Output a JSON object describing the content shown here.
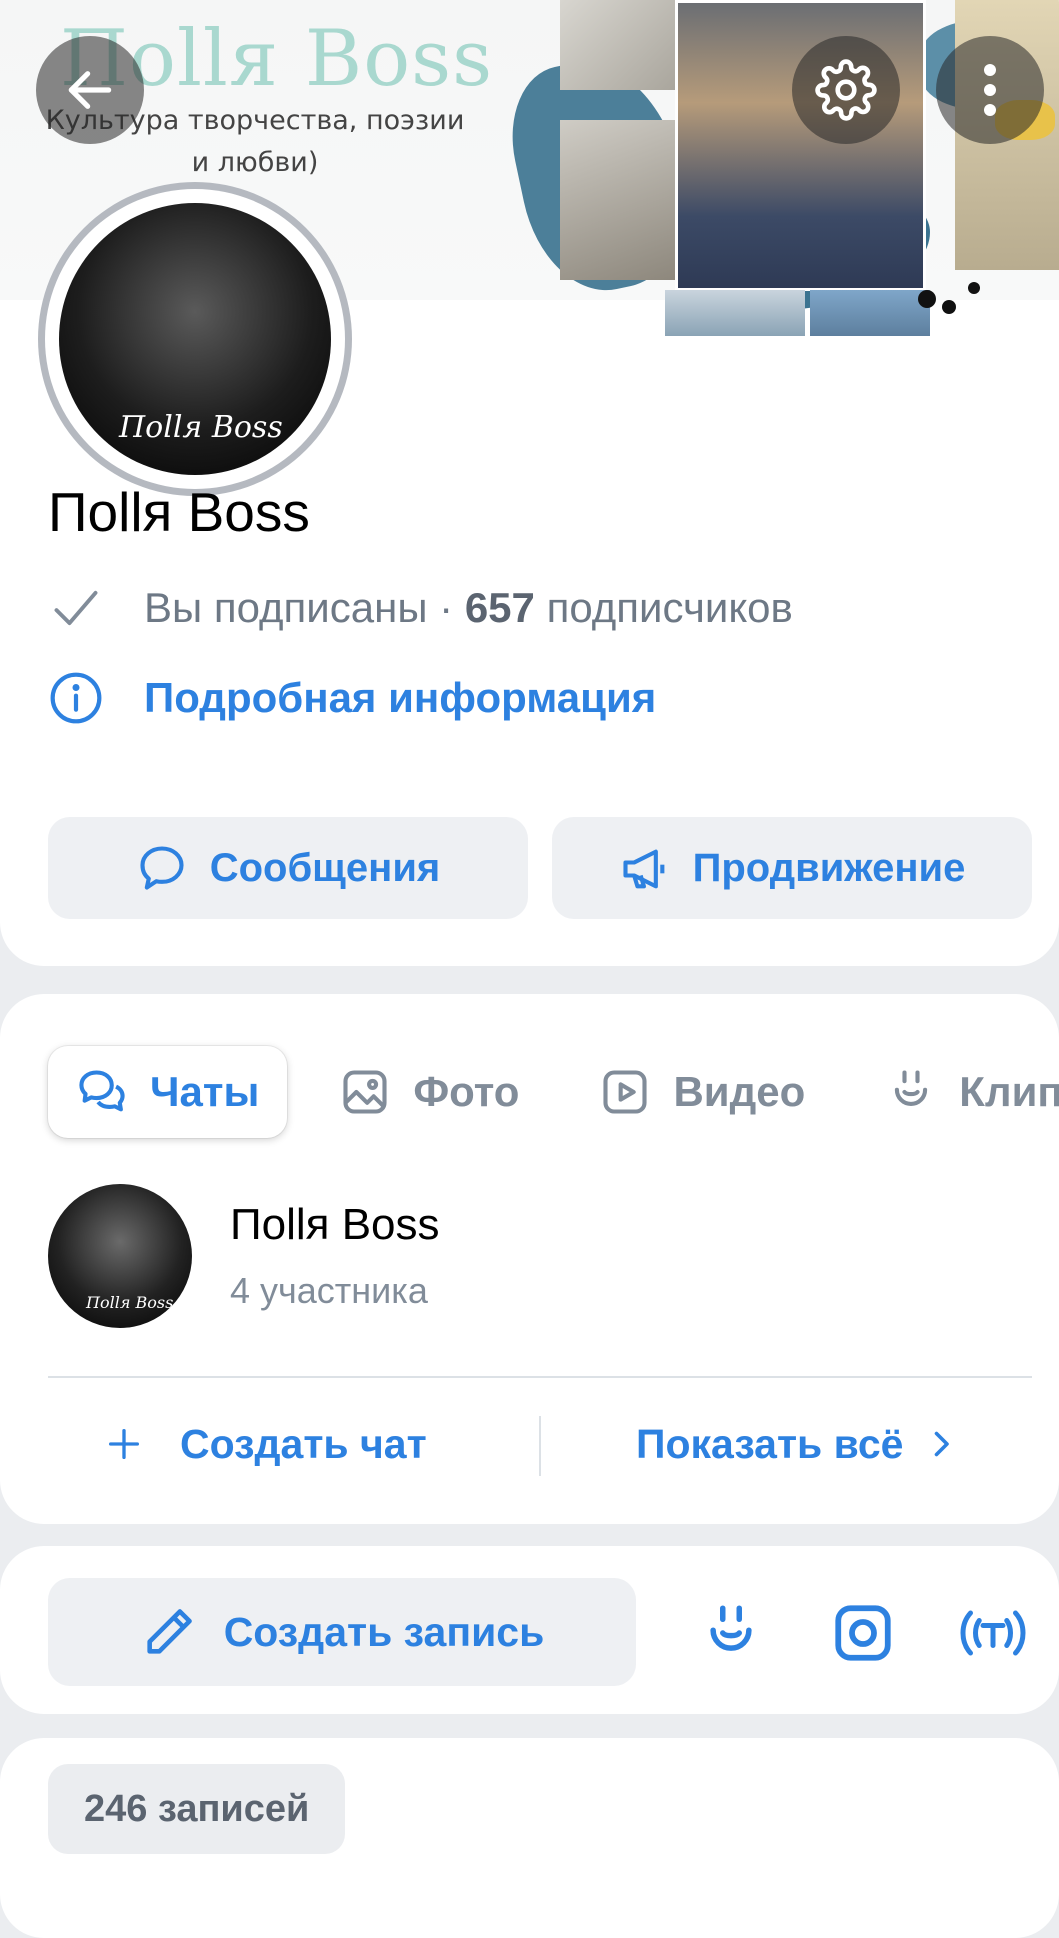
{
  "cover": {
    "title": "Поllя Boss",
    "subtitle_line1": "Культура творчества, поэзии",
    "subtitle_line2": "и любви)"
  },
  "avatar": {
    "logo_text": "Поllя Boss"
  },
  "group": {
    "name": "Поllя Boss",
    "subscribed_text": "Вы подписаны · ",
    "subscribers_count": "657",
    "subscribers_label": " подписчиков",
    "info_link": "Подробная информация"
  },
  "actions": {
    "messages_label": "Сообщения",
    "promotion_label": "Продвижение"
  },
  "tabs": [
    {
      "label": "Чаты",
      "icon": "chats-icon",
      "active": true
    },
    {
      "label": "Фото",
      "icon": "photo-icon",
      "active": false
    },
    {
      "label": "Видео",
      "icon": "video-icon",
      "active": false
    },
    {
      "label": "Клип",
      "icon": "clips-icon",
      "active": false
    }
  ],
  "chat": {
    "title": "Поllя Boss",
    "members": "4 участника",
    "avatar_text": "Поllя Boss"
  },
  "chat_actions": {
    "create_label": "Создать чат",
    "show_all_label": "Показать всё"
  },
  "post": {
    "create_label": "Создать запись",
    "extra_icons": [
      "clips-icon",
      "instagram-icon",
      "live-icon"
    ]
  },
  "posts": {
    "count_label": "246 записей"
  },
  "colors": {
    "accent": "#2d81e0",
    "background": "#ebedf0",
    "button_bg": "#eef0f3",
    "secondary_text": "#818c99"
  }
}
